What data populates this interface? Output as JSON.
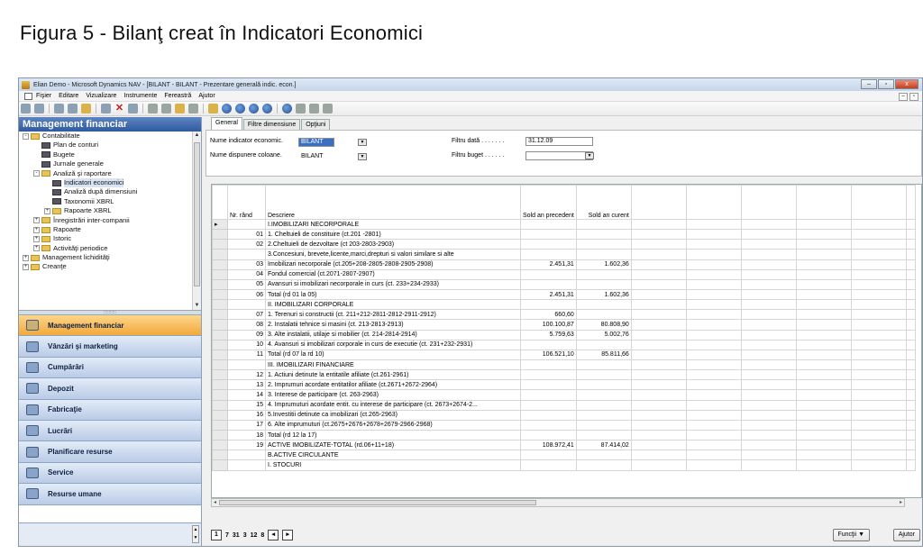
{
  "figure_title": "Figura 5 -   Bilanţ creat  în Indicatori Economici",
  "window": {
    "title": "Elian Demo - Microsoft Dynamics NAV - [BILANT - BILANT - Prezentare generală indic. econ.]",
    "buttons": [
      "–",
      "▫",
      "x"
    ]
  },
  "menu": [
    "Fişier",
    "Editare",
    "Vizualizare",
    "Instrumente",
    "Fereastră",
    "Ajutor"
  ],
  "nav": {
    "header": "Management financiar",
    "tree": [
      {
        "label": "Contabilitate",
        "type": "folder",
        "level": 0,
        "exp": "-"
      },
      {
        "label": "Plan de conturi",
        "type": "page",
        "level": 1
      },
      {
        "label": "Bugete",
        "type": "page",
        "level": 1
      },
      {
        "label": "Jurnale generale",
        "type": "page",
        "level": 1
      },
      {
        "label": "Analiză şi raportare",
        "type": "folder",
        "level": 1,
        "exp": "-"
      },
      {
        "label": "Indicatori economici",
        "type": "page",
        "level": 2,
        "selected": true
      },
      {
        "label": "Analiză după dimensiuni",
        "type": "page",
        "level": 2
      },
      {
        "label": "Taxonomii XBRL",
        "type": "page",
        "level": 2
      },
      {
        "label": "Rapoarte XBRL",
        "type": "folder",
        "level": 2,
        "exp": "+"
      },
      {
        "label": "Înregistrări inter-companii",
        "type": "folder",
        "level": 1,
        "exp": "+"
      },
      {
        "label": "Rapoarte",
        "type": "folder",
        "level": 1,
        "exp": "+"
      },
      {
        "label": "Istoric",
        "type": "folder",
        "level": 1,
        "exp": "+"
      },
      {
        "label": "Activităţi periodice",
        "type": "folder",
        "level": 1,
        "exp": "+"
      },
      {
        "label": "Management lichidităţi",
        "type": "folder",
        "level": 0,
        "exp": "+"
      },
      {
        "label": "Creanţe",
        "type": "folder",
        "level": 0,
        "exp": "+"
      }
    ],
    "buttons": [
      "Management financiar",
      "Vânzări şi marketing",
      "Cumpărări",
      "Depozit",
      "Fabricaţie",
      "Lucrări",
      "Planificare resurse",
      "Service",
      "Resurse umane"
    ]
  },
  "tabs": [
    "General",
    "Filtre dimensiune",
    "Opţiuni"
  ],
  "form": {
    "name_label": "Nume indicator economic.",
    "name_value": "BILANT",
    "layout_label": "Nume dispunere coloane.",
    "layout_value": "BILANT",
    "date_label": "Filtru dată  . . . . . . .",
    "date_value": "31.12.09",
    "budget_label": "Filtru buget . . . . . .",
    "budget_value": ""
  },
  "table": {
    "headers": {
      "rn": "Nr. rând",
      "desc": "Descriere",
      "prev": "Sold an precedent",
      "curr": "Sold an curent"
    },
    "rows": [
      {
        "rn": "",
        "desc": "I.IMOBILIZARI NECORPORALE",
        "prev": "",
        "curr": ""
      },
      {
        "rn": "01",
        "desc": "1. Cheltuieli de constituire (ct.201 -2801)",
        "prev": "",
        "curr": ""
      },
      {
        "rn": "02",
        "desc": "2.Cheltuieli de dezvoltare (ct 203-2803-2903)",
        "prev": "",
        "curr": ""
      },
      {
        "rn": "",
        "desc": "3.Concesiuni, brevete,licente,marci,drepturi si valori similare si alte",
        "prev": "",
        "curr": ""
      },
      {
        "rn": "03",
        "desc": "Imobilizari necorporale (ct.205+208-2805-2808-2905-2908)",
        "prev": "2.451,31",
        "curr": "1.602,36"
      },
      {
        "rn": "04",
        "desc": "Fondul comercial (ct.2071-2807-2907)",
        "prev": "",
        "curr": ""
      },
      {
        "rn": "05",
        "desc": "Avansuri si imobilizari necorporale in curs (ct. 233+234-2933)",
        "prev": "",
        "curr": ""
      },
      {
        "rn": "06",
        "desc": "Total (rd 01 la 05)",
        "prev": "2.451,31",
        "curr": "1.602,36"
      },
      {
        "rn": "",
        "desc": "II. IMOBILIZARI CORPORALE",
        "prev": "",
        "curr": ""
      },
      {
        "rn": "07",
        "desc": "1. Terenuri si constructii (ct. 211+212-2811-2812-2911-2912)",
        "prev": "660,60",
        "curr": ""
      },
      {
        "rn": "08",
        "desc": "2. Instalatii tehnice si masini (ct. 213-2813-2913)",
        "prev": "100.100,87",
        "curr": "80.808,90"
      },
      {
        "rn": "09",
        "desc": "3. Alte instalatii, utilaje si mobilier (ct. 214-2814-2914)",
        "prev": "5.759,63",
        "curr": "5.002,76"
      },
      {
        "rn": "10",
        "desc": "4. Avansuri si imobilizari corporale in curs de executie  (ct. 231+232-2931)",
        "prev": "",
        "curr": ""
      },
      {
        "rn": "11",
        "desc": "Total (rd 07 la rd 10)",
        "prev": "106.521,10",
        "curr": "85.811,66"
      },
      {
        "rn": "",
        "desc": "III. IMOBILIZARI FINANCIARE",
        "prev": "",
        "curr": ""
      },
      {
        "rn": "12",
        "desc": "1. Actiuni detinute la entitatile afiliate (ct.261-2961)",
        "prev": "",
        "curr": ""
      },
      {
        "rn": "13",
        "desc": "2. Imprumuri acordate entitatilor afiliate (ct.2671+2672-2964)",
        "prev": "",
        "curr": ""
      },
      {
        "rn": "14",
        "desc": "3. Interese de participare (ct. 263-2963)",
        "prev": "",
        "curr": ""
      },
      {
        "rn": "15",
        "desc": "4. Imprumuturi acordate entit. cu interese de participare (ct. 2673+2674-2...",
        "prev": "",
        "curr": ""
      },
      {
        "rn": "16",
        "desc": "5.Investitii detinute ca imobilizari (ct.265-2963)",
        "prev": "",
        "curr": ""
      },
      {
        "rn": "17",
        "desc": "6. Alte imprumuturi (ct.2675+2676+2678+2679-2966-2968)",
        "prev": "",
        "curr": ""
      },
      {
        "rn": "18",
        "desc": "Total (rd 12 la 17)",
        "prev": "",
        "curr": ""
      },
      {
        "rn": "19",
        "desc": "ACTIVE IMOBILIZATE-TOTAL (rd.06+11+18)",
        "prev": "108.972,41",
        "curr": "87.414,02"
      },
      {
        "rn": "",
        "desc": "B.ACTIVE CIRCULANTE",
        "prev": "",
        "curr": ""
      },
      {
        "rn": "",
        "desc": "I. STOCURI",
        "prev": "",
        "curr": ""
      }
    ]
  },
  "pager": [
    "1",
    "7",
    "31",
    "3",
    "12",
    "8"
  ],
  "bottom_buttons": {
    "functions": "Funcţii",
    "help": "Ajutor"
  },
  "icons": [
    "app-icon",
    "menu-doc-icon",
    "cut-icon",
    "copy-icon",
    "paste-icon",
    "delete-icon",
    "search-icon",
    "nav-arrow-icon"
  ]
}
